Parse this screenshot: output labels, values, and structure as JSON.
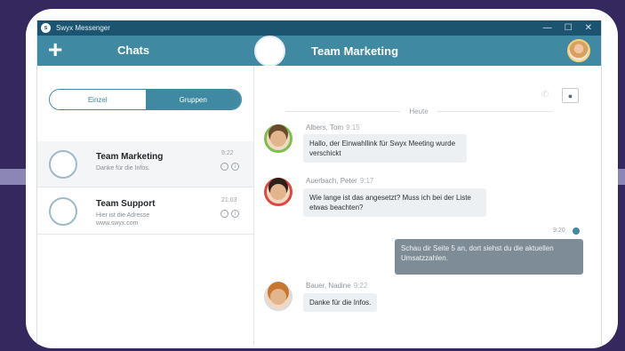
{
  "window": {
    "title": "Swyx Messenger",
    "app_icon": "swyx-logo-icon",
    "controls": [
      "—",
      "☐",
      "✕"
    ]
  },
  "header": {
    "add_button": "+",
    "chats_title": "Chats",
    "conversation_title": "Team Marketing"
  },
  "sidebar": {
    "segments": [
      {
        "label": "Einzel",
        "active": false
      },
      {
        "label": "Gruppen",
        "active": true
      }
    ],
    "chats": [
      {
        "name": "Team Marketing",
        "preview": "Danke für die Infos.",
        "time": "9:22",
        "selected": true
      },
      {
        "name": "Team Support",
        "preview": "Hier ist die Adresse www.swyx.com",
        "time": "21:03",
        "selected": false
      }
    ]
  },
  "conversation": {
    "date_separator": "Heute",
    "messages": [
      {
        "sender": "Albers, Tom",
        "time": "9:15",
        "text": "Hallo, der Einwahllink für Swyx Meeting wurde verschickt",
        "ring": "#7cc04a"
      },
      {
        "sender": "Auerbach, Peter",
        "time": "9:17",
        "text": "Wie lange ist das angesetzt? Muss ich bei der Liste etwas beachten?",
        "ring": "#e0463e"
      },
      {
        "sender": "",
        "time": "9:20",
        "text": "Schau dir Seite 5 an, dort siehst du die aktuellen Umsatzzahlen.",
        "outgoing": true
      },
      {
        "sender": "Bauer, Nadine",
        "time": "9:22",
        "text": "Danke für die Infos.",
        "ring": "#d7dde2"
      }
    ]
  },
  "colors": {
    "accent": "#3f8aa2",
    "titlebar": "#1c5470",
    "background": "#35285e"
  }
}
